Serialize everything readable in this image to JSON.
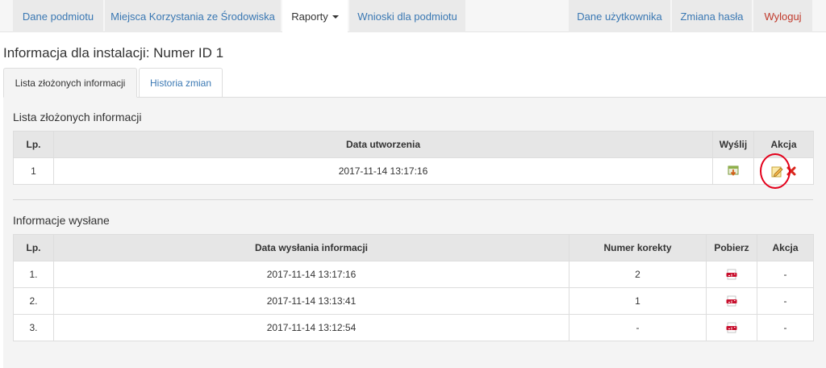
{
  "nav": {
    "left": [
      "Dane podmiotu",
      "Miejsca Korzystania ze Środowiska",
      "Raporty",
      "Wnioski dla podmiotu"
    ],
    "right": [
      "Dane użytkownika",
      "Zmiana hasła",
      "Wyloguj"
    ]
  },
  "page_title": "Informacja dla instalacji: Numer ID 1",
  "tabs": [
    "Lista złożonych informacji",
    "Historia zmian"
  ],
  "submitted": {
    "title": "Lista złożonych informacji",
    "headers": [
      "Lp.",
      "Data utworzenia",
      "Wyślij",
      "Akcja"
    ],
    "rows": [
      {
        "lp": "1",
        "date": "2017-11-14 13:17:16"
      }
    ]
  },
  "sent": {
    "title": "Informacje wysłane",
    "headers": [
      "Lp.",
      "Data wysłania informacji",
      "Numer korekty",
      "Pobierz",
      "Akcja"
    ],
    "rows": [
      {
        "lp": "1.",
        "date": "2017-11-14 13:17:16",
        "correction": "2",
        "action": "-"
      },
      {
        "lp": "2.",
        "date": "2017-11-14 13:13:41",
        "correction": "1",
        "action": "-"
      },
      {
        "lp": "3.",
        "date": "2017-11-14 13:12:54",
        "correction": "-",
        "action": "-"
      }
    ]
  },
  "icons": {
    "send": "send-download-icon",
    "edit": "edit-icon",
    "delete": "delete-icon",
    "pdf": "pdf-icon"
  },
  "colors": {
    "link": "#3a78b3",
    "logout": "#c0392b",
    "highlight": "#e3001b"
  }
}
